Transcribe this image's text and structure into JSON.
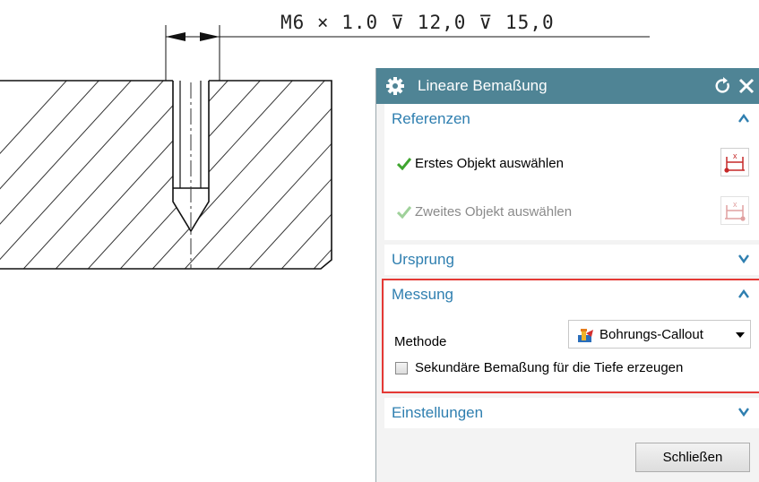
{
  "drawing": {
    "callout": "M6 × 1.0 ⊽ 12,0 ⊽ 15,0"
  },
  "dialog": {
    "title": "Lineare Bemaßung",
    "reset_icon": "reset-icon",
    "close_icon": "close-icon",
    "sections": {
      "referenzen": {
        "title": "Referenzen",
        "expanded": true,
        "first_object": "Erstes Objekt auswählen",
        "second_object": "Zweites Objekt auswählen"
      },
      "ursprung": {
        "title": "Ursprung",
        "expanded": false
      },
      "messung": {
        "title": "Messung",
        "expanded": true,
        "method_label": "Methode",
        "method_value": "Bohrungs-Callout",
        "secondary_checkbox_label": "Sekundäre Bemaßung für die Tiefe erzeugen",
        "secondary_checked": false
      },
      "einstellungen": {
        "title": "Einstellungen",
        "expanded": false
      }
    },
    "close_button": "Schließen"
  },
  "colors": {
    "titlebar": "#4f8495",
    "section_title": "#2f7fb0",
    "check_active": "#3fa52f",
    "check_inactive": "#9fd19a",
    "highlight_frame": "#e53935"
  }
}
